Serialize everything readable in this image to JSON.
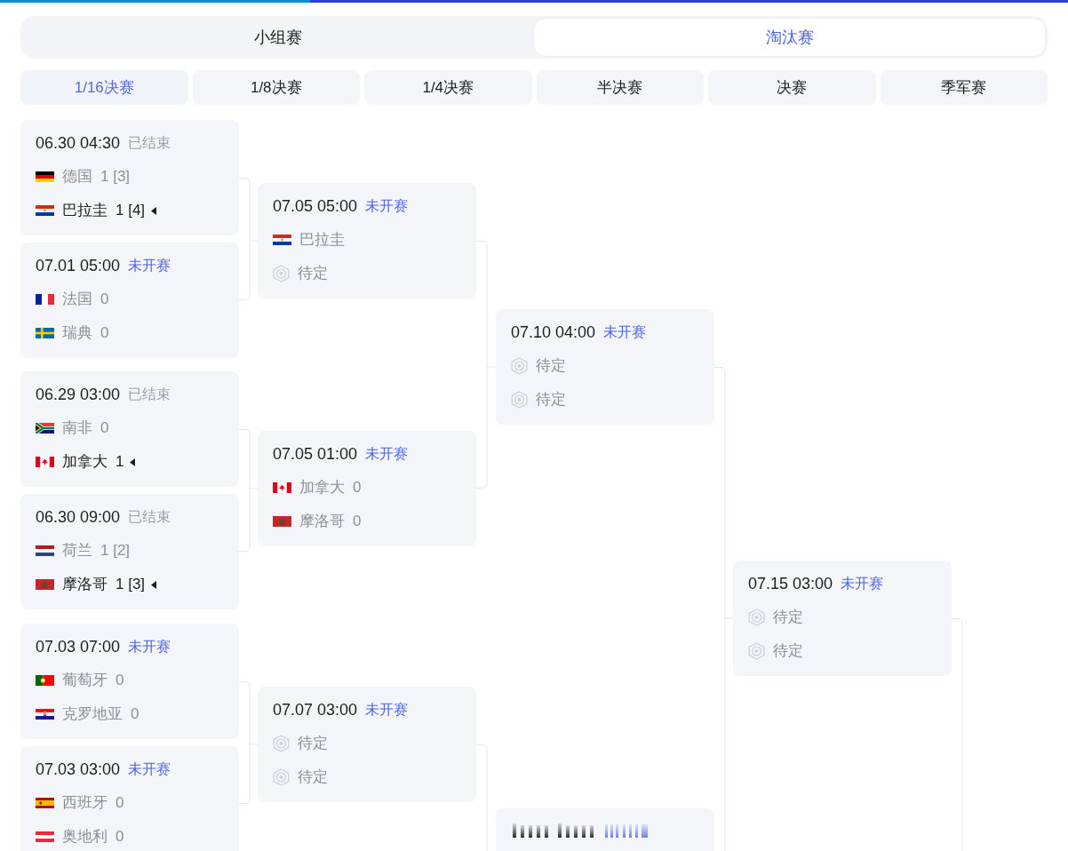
{
  "top_tabs": [
    {
      "label": "小组赛",
      "selected": false
    },
    {
      "label": "淘汰赛",
      "selected": true
    }
  ],
  "round_tabs": [
    {
      "label": "1/16决赛",
      "selected": true
    },
    {
      "label": "1/8决赛",
      "selected": false
    },
    {
      "label": "1/4决赛",
      "selected": false
    },
    {
      "label": "半决赛",
      "selected": false
    },
    {
      "label": "决赛",
      "selected": false
    },
    {
      "label": "季军赛",
      "selected": false
    }
  ],
  "bracket": {
    "columns": [
      {
        "matches": [
          {
            "kind": "match",
            "time": "06.30 04:30",
            "status": "已结束",
            "finished": true,
            "teams": [
              {
                "kind": "team",
                "flag": {
                  "kind": "de"
                },
                "name": "德国",
                "score": "1 [3]",
                "winner": false
              },
              {
                "kind": "team",
                "flag": {
                  "kind": "py"
                },
                "name": "巴拉圭",
                "score": "1 [4]",
                "winner": true
              }
            ]
          },
          {
            "kind": "match",
            "time": "07.01 05:00",
            "status": "未开赛",
            "finished": false,
            "teams": [
              {
                "kind": "team",
                "flag": {
                  "kind": "fr"
                },
                "name": "法国",
                "score": "0",
                "winner": false
              },
              {
                "kind": "team",
                "flag": {
                  "kind": "se"
                },
                "name": "瑞典",
                "score": "0",
                "winner": false
              }
            ]
          },
          {
            "kind": "match",
            "time": "06.29 03:00",
            "status": "已结束",
            "finished": true,
            "teams": [
              {
                "kind": "team",
                "flag": {
                  "kind": "za"
                },
                "name": "南非",
                "score": "0",
                "winner": false
              },
              {
                "kind": "team",
                "flag": {
                  "kind": "ca"
                },
                "name": "加拿大",
                "score": "1",
                "winner": true
              }
            ]
          },
          {
            "kind": "match",
            "time": "06.30 09:00",
            "status": "已结束",
            "finished": true,
            "teams": [
              {
                "kind": "team",
                "flag": {
                  "kind": "nl"
                },
                "name": "荷兰",
                "score": "1 [2]",
                "winner": false
              },
              {
                "kind": "team",
                "flag": {
                  "kind": "ma"
                },
                "name": "摩洛哥",
                "score": "1 [3]",
                "winner": true
              }
            ]
          },
          {
            "kind": "match",
            "time": "07.03 07:00",
            "status": "未开赛",
            "finished": false,
            "teams": [
              {
                "kind": "team",
                "flag": {
                  "kind": "pt"
                },
                "name": "葡萄牙",
                "score": "0",
                "winner": false
              },
              {
                "kind": "team",
                "flag": {
                  "kind": "hr"
                },
                "name": "克罗地亚",
                "score": "0",
                "winner": false
              }
            ]
          },
          {
            "kind": "match",
            "time": "07.03 03:00",
            "status": "未开赛",
            "finished": false,
            "teams": [
              {
                "kind": "team",
                "flag": {
                  "kind": "es"
                },
                "name": "西班牙",
                "score": "0",
                "winner": false
              },
              {
                "kind": "team",
                "flag": {
                  "kind": "at"
                },
                "name": "奥地利",
                "score": "0",
                "winner": false
              }
            ]
          }
        ]
      },
      {
        "matches": [
          {
            "kind": "match",
            "time": "07.05 05:00",
            "status": "未开赛",
            "finished": false,
            "teams": [
              {
                "kind": "team",
                "flag": {
                  "kind": "py"
                },
                "name": "巴拉圭",
                "winner": false
              },
              {
                "kind": "tbd",
                "name": "待定"
              }
            ]
          },
          {
            "kind": "match",
            "time": "07.05 01:00",
            "status": "未开赛",
            "finished": false,
            "teams": [
              {
                "kind": "team",
                "flag": {
                  "kind": "ca"
                },
                "name": "加拿大",
                "score": "0",
                "winner": false
              },
              {
                "kind": "team",
                "flag": {
                  "kind": "ma"
                },
                "name": "摩洛哥",
                "score": "0",
                "winner": false
              }
            ]
          },
          {
            "kind": "match",
            "time": "07.07 03:00",
            "status": "未开赛",
            "finished": false,
            "teams": [
              {
                "kind": "tbd",
                "name": "待定"
              },
              {
                "kind": "tbd",
                "name": "待定"
              }
            ]
          }
        ]
      },
      {
        "matches": [
          {
            "kind": "match",
            "time": "07.10 04:00",
            "status": "未开赛",
            "finished": false,
            "teams": [
              {
                "kind": "tbd",
                "name": "待定"
              },
              {
                "kind": "tbd",
                "name": "待定"
              }
            ]
          },
          {
            "kind": "blurred"
          }
        ]
      },
      {
        "matches": [
          {
            "kind": "match",
            "time": "07.15 03:00",
            "status": "未开赛",
            "finished": false,
            "teams": [
              {
                "kind": "tbd",
                "name": "待定"
              },
              {
                "kind": "tbd",
                "name": "待定"
              }
            ]
          }
        ]
      }
    ]
  }
}
